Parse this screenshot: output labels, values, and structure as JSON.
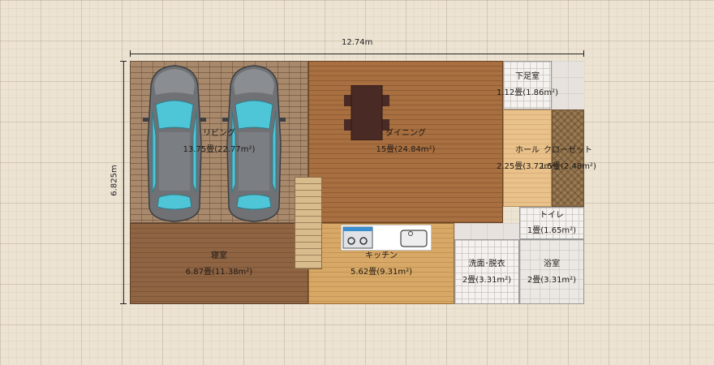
{
  "dimensions": {
    "width_label": "12.74m",
    "height_label": "6.825m"
  },
  "rooms": {
    "living": {
      "name": "リビング",
      "area": "13.75畳(22.77m²)"
    },
    "dining": {
      "name": "ダイニング",
      "area": "15畳(24.84m²)"
    },
    "shoe": {
      "name": "下足室",
      "area": "1.12畳(1.86m²)"
    },
    "hall": {
      "name": "ホール",
      "area": "2.25畳(3.72m²)"
    },
    "closet": {
      "name": "クローゼット",
      "area": "1.5畳(2.48m²)"
    },
    "toilet": {
      "name": "トイレ",
      "area": "1畳(1.65m²)"
    },
    "bedroom": {
      "name": "寝室",
      "area": "6.87畳(11.38m²)"
    },
    "kitchen": {
      "name": "キッチン",
      "area": "5.62畳(9.31m²)"
    },
    "washroom": {
      "name": "洗面･脱衣",
      "area": "2畳(3.31m²)"
    },
    "bathroom": {
      "name": "浴室",
      "area": "2畳(3.31m²)"
    }
  },
  "colors": {
    "car_body": "#6f7174",
    "car_glass": "#4fc6d8",
    "table": "#4a2a24"
  }
}
